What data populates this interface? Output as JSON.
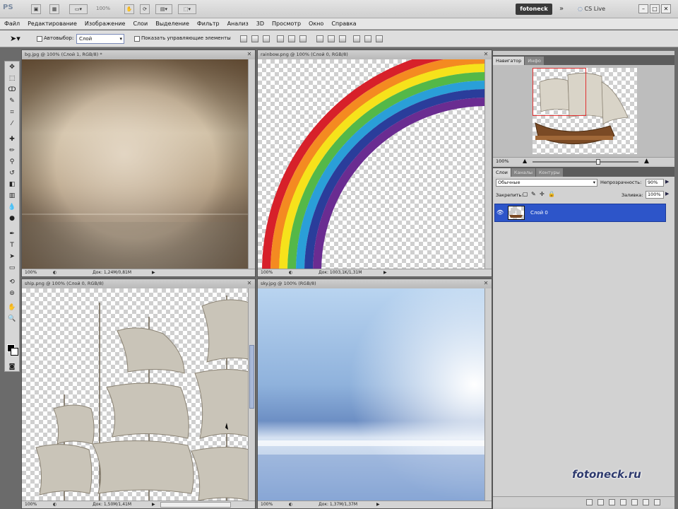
{
  "app": {
    "logo": "PS",
    "zoom_select": "100%",
    "workspace_button": "fotoneck",
    "cs_live": "CS Live",
    "more_chevron": "»",
    "win_controls": [
      "–",
      "□",
      "✕"
    ]
  },
  "menu": [
    "Файл",
    "Редактирование",
    "Изображение",
    "Слои",
    "Выделение",
    "Фильтр",
    "Анализ",
    "3D",
    "Просмотр",
    "Окно",
    "Справка"
  ],
  "options": {
    "auto_select_label": "Автовыбор:",
    "auto_select_value": "Слой",
    "show_transform_label": "Показать управляющие элементы"
  },
  "documents": [
    {
      "title": "bg.jpg @ 100% (Слой 1, RGB/8) *",
      "zoom": "100%",
      "doc_info": "Док: 1,24M/0,81M"
    },
    {
      "title": "rainbow.png @ 100% (Слой 0, RGB/8)",
      "zoom": "100%",
      "doc_info": "Док: 1003,1K/1,31M"
    },
    {
      "title": "ship.png @ 100% (Слой 0, RGB/8)",
      "zoom": "100%",
      "doc_info": "Док: 1,50M/1,41M"
    },
    {
      "title": "sky.jpg @ 100% (RGB/8)",
      "zoom": "100%",
      "doc_info": "Док: 1,37M/1,37M"
    }
  ],
  "navigator": {
    "tabs": [
      "Навигатор",
      "Инфо"
    ],
    "zoom": "100%"
  },
  "layers_panel": {
    "tabs": [
      "Слои",
      "Каналы",
      "Контуры"
    ],
    "blend_mode": "Обычные",
    "opacity_label": "Непрозрачность:",
    "opacity_value": "90%",
    "lock_label": "Закрепить:",
    "fill_label": "Заливка:",
    "fill_value": "100%",
    "layers": [
      {
        "name": "Слой 0",
        "visible": true,
        "selected": true
      }
    ]
  },
  "watermark": "fotoneck.ru",
  "colors": {
    "selection": "#2d55c9",
    "rainbow": [
      "#d7202a",
      "#f48a21",
      "#f6e21b",
      "#54b848",
      "#2a9fd8",
      "#2a3d9b",
      "#6a2c91"
    ]
  }
}
